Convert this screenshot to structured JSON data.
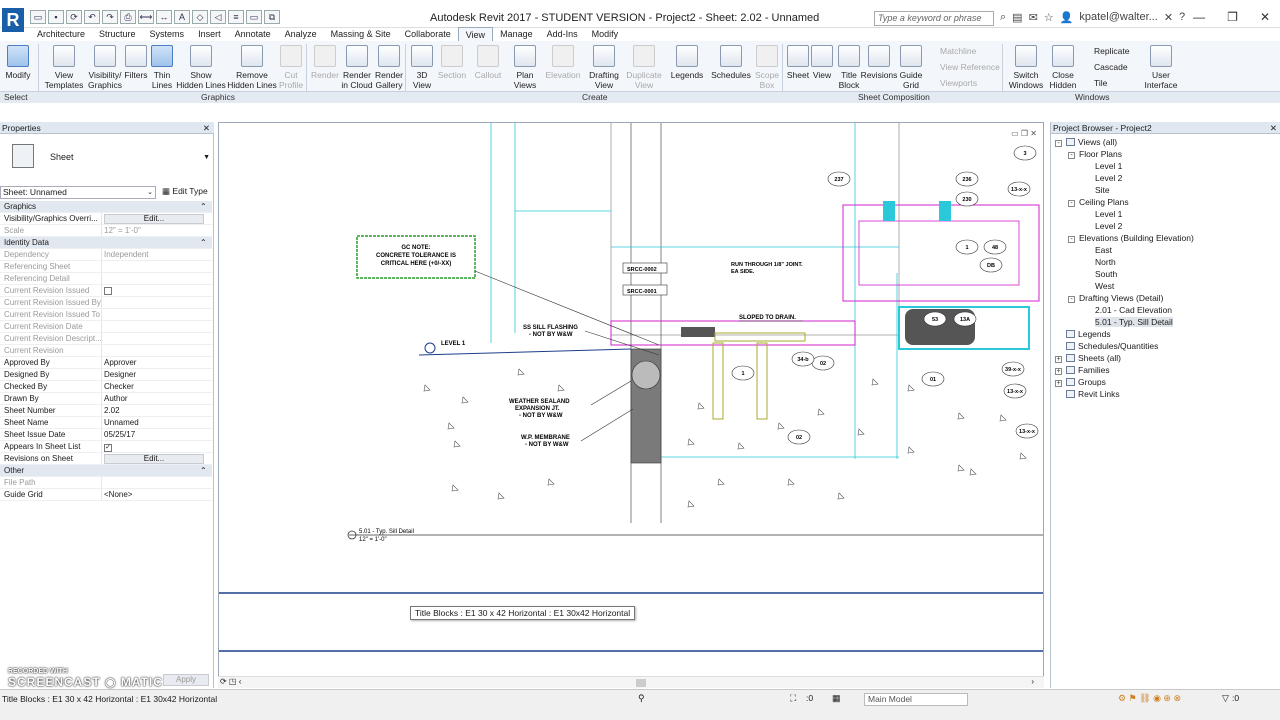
{
  "app": {
    "logo": "R",
    "title": "Autodesk Revit 2017 - STUDENT VERSION -   Project2 - Sheet: 2.02 - Unnamed",
    "search_placeholder": "Type a keyword or phrase",
    "user": "kpatel@walter...",
    "help": "?"
  },
  "tabs": [
    "Architecture",
    "Structure",
    "Systems",
    "Insert",
    "Annotate",
    "Analyze",
    "Massing & Site",
    "Collaborate",
    "View",
    "Manage",
    "Add-Ins",
    "Modify"
  ],
  "ribbon": {
    "modify": "Modify",
    "select": "Select",
    "graphics_buttons": [
      "View Templates",
      "Visibility/ Graphics",
      "Filters",
      "Thin Lines",
      "Show Hidden Lines",
      "Remove Hidden Lines",
      "Cut Profile"
    ],
    "render_buttons": [
      "Render",
      "Render in Cloud",
      "Render Gallery"
    ],
    "create_buttons": [
      "3D View",
      "Section",
      "Callout",
      "Plan Views",
      "Elevation",
      "Drafting View",
      "Duplicate View",
      "Legends",
      "Schedules",
      "Scope Box"
    ],
    "sheet_buttons": [
      "Sheet",
      "View",
      "Title Block",
      "Revisions",
      "Guide Grid"
    ],
    "sheet_small": [
      "Matchline",
      "View Reference",
      "Viewports"
    ],
    "windows_buttons": [
      "Switch Windows",
      "Close Hidden"
    ],
    "windows_small": [
      "Replicate",
      "Cascade",
      "Tile"
    ],
    "ui_button": "User Interface",
    "group_labels": [
      "Select",
      "Graphics",
      "Create",
      "Sheet Composition",
      "Windows"
    ]
  },
  "properties": {
    "header": "Properties",
    "type_name": "Sheet",
    "instance": "Sheet: Unnamed",
    "edit_type": "Edit Type",
    "rows": [
      {
        "k": "Graphics",
        "section": true
      },
      {
        "k": "Visibility/Graphics Overri...",
        "v": "Edit...",
        "button": true
      },
      {
        "k": "Scale",
        "v": "12\" = 1'-0\"",
        "grey": true
      },
      {
        "k": "Identity Data",
        "section": true
      },
      {
        "k": "Dependency",
        "v": "Independent",
        "grey": true
      },
      {
        "k": "Referencing Sheet",
        "v": "",
        "grey": true
      },
      {
        "k": "Referencing Detail",
        "v": "",
        "grey": true
      },
      {
        "k": "Current Revision Issued",
        "v": "",
        "grey": true,
        "check": true
      },
      {
        "k": "Current Revision Issued By",
        "v": "",
        "grey": true
      },
      {
        "k": "Current Revision Issued To",
        "v": "",
        "grey": true
      },
      {
        "k": "Current Revision Date",
        "v": "",
        "grey": true
      },
      {
        "k": "Current Revision Descript...",
        "v": "",
        "grey": true
      },
      {
        "k": "Current Revision",
        "v": "",
        "grey": true
      },
      {
        "k": "Approved By",
        "v": "Approver"
      },
      {
        "k": "Designed By",
        "v": "Designer"
      },
      {
        "k": "Checked By",
        "v": "Checker"
      },
      {
        "k": "Drawn By",
        "v": "Author"
      },
      {
        "k": "Sheet Number",
        "v": "2.02"
      },
      {
        "k": "Sheet Name",
        "v": "Unnamed"
      },
      {
        "k": "Sheet Issue Date",
        "v": "05/25/17"
      },
      {
        "k": "Appears In Sheet List",
        "v": "",
        "check": true,
        "checked": true
      },
      {
        "k": "Revisions on Sheet",
        "v": "Edit...",
        "button": true
      },
      {
        "k": "Other",
        "section": true
      },
      {
        "k": "File Path",
        "v": "",
        "grey": true
      },
      {
        "k": "Guide Grid",
        "v": "<None>"
      }
    ],
    "help": "Properties help",
    "apply": "Apply"
  },
  "browser": {
    "header": "Project Browser - Project2",
    "tree": [
      {
        "label": "Views (all)",
        "lvl": 0,
        "tg": "-"
      },
      {
        "label": "Floor Plans",
        "lvl": 1,
        "tg": "-"
      },
      {
        "label": "Level 1",
        "lvl": 2
      },
      {
        "label": "Level 2",
        "lvl": 2
      },
      {
        "label": "Site",
        "lvl": 2
      },
      {
        "label": "Ceiling Plans",
        "lvl": 1,
        "tg": "-"
      },
      {
        "label": "Level 1",
        "lvl": 2
      },
      {
        "label": "Level 2",
        "lvl": 2
      },
      {
        "label": "Elevations (Building Elevation)",
        "lvl": 1,
        "tg": "-"
      },
      {
        "label": "East",
        "lvl": 2
      },
      {
        "label": "North",
        "lvl": 2
      },
      {
        "label": "South",
        "lvl": 2
      },
      {
        "label": "West",
        "lvl": 2
      },
      {
        "label": "Drafting Views (Detail)",
        "lvl": 1,
        "tg": "-"
      },
      {
        "label": "2.01 - Cad Elevation",
        "lvl": 2
      },
      {
        "label": "5.01 - Typ. Sill Detail",
        "lvl": 2,
        "sel": true
      },
      {
        "label": "Legends",
        "lvl": 0,
        "icon": true
      },
      {
        "label": "Schedules/Quantities",
        "lvl": 0,
        "icon": true
      },
      {
        "label": "Sheets (all)",
        "lvl": 0,
        "tg": "+",
        "icon": true
      },
      {
        "label": "Families",
        "lvl": 0,
        "tg": "+",
        "icon": true
      },
      {
        "label": "Groups",
        "lvl": 0,
        "tg": "+",
        "icon": true
      },
      {
        "label": "Revit Links",
        "lvl": 0,
        "icon": true
      }
    ]
  },
  "drawing": {
    "gc_note": [
      "GC NOTE:",
      "CONCRETE TOLERANCE IS",
      "CRITICAL HERE (+0/-XX)"
    ],
    "level": "LEVEL 1",
    "ss_flashing": [
      "SS SILL FLASHING",
      "- NOT BY W&W"
    ],
    "weather": [
      "WEATHER SEALAND",
      "EXPANSION JT.",
      "- NOT BY W&W"
    ],
    "membrane": [
      "W.P. MEMBRANE",
      "- NOT BY W&W"
    ],
    "srcc1": "SRCC-0002",
    "srcc2": "SRCC-0001",
    "run_through": [
      "RUN THROUGH 1/8\" JOINT.",
      "EA SIDE."
    ],
    "sloped": "SLOPED TO DRAIN.",
    "view_title": "5.01 - Typ. Sill Detail",
    "view_scale": "12\" = 1'-0\"",
    "tags": [
      "237",
      "236",
      "230",
      "1",
      "48",
      "DB",
      "13-x-x",
      "53",
      "13A",
      "01",
      "02",
      "1",
      "02",
      "39-x-x",
      "13-x-x",
      "13-x-x",
      "34-b",
      "3"
    ]
  },
  "tooltip": "Title Blocks : E1 30 x 42 Horizontal : E1 30x42 Horizontal",
  "status": {
    "text": "Title Blocks : E1 30 x 42 Horizontal : E1 30x42 Horizontal",
    "model": "Main Model",
    "zero1": ":0",
    "zero2": ":0"
  },
  "watermark": {
    "line1": "RECORDED WITH",
    "line2": "SCREENCAST",
    "line3": "MATIC"
  }
}
